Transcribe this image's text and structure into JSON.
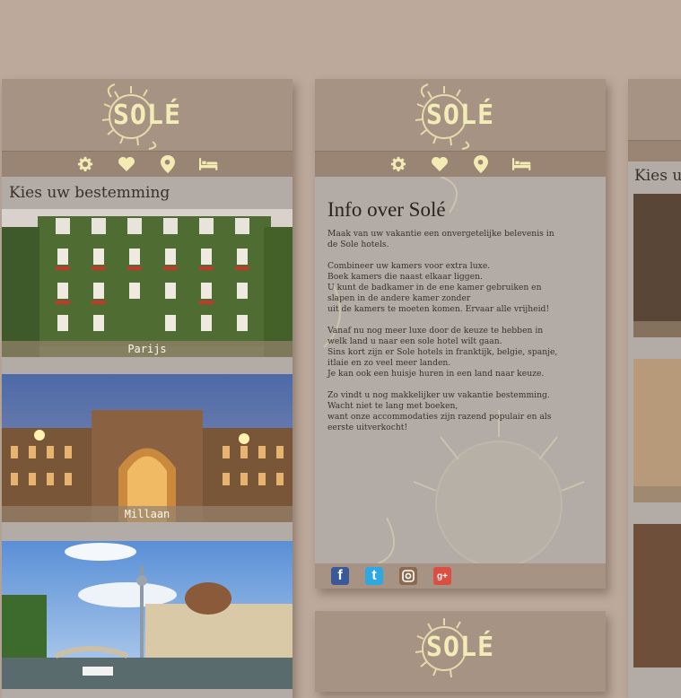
{
  "brand": {
    "logo_text": "SOLÉ"
  },
  "nav": {
    "settings_icon": "gear-icon",
    "favorites_icon": "heart-icon",
    "location_icon": "map-pin-icon",
    "booking_icon": "bed-icon"
  },
  "destinations_panel": {
    "title": "Kies uw bestemming",
    "cards": [
      {
        "label": "Parijs"
      },
      {
        "label": "Millaan"
      },
      {
        "label": ""
      }
    ]
  },
  "info_panel": {
    "title": "Info over Solé",
    "paragraphs": [
      "Maak van uw vakantie een onvergetelijke belevenis in\nde Sole hotels.",
      "Combineer uw kamers voor extra luxe.\nBoek kamers die naast elkaar liggen.\nU kunt de badkamer in de ene kamer gebruiken en\nslapen in de andere kamer zonder\nuit de kamers te moeten komen. Ervaar alle vrijheid!",
      "Vanaf nu nog meer luxe door de keuze te hebben in\nwelk land u naar een sole hotel wilt gaan.\nSins kort zijn er Sole hotels in franktijk, belgie, spanje,\nitlaie en zo veel meer landen.\nJe kan ook een huisje huren in een land naar keuze.",
      "Zo vindt u nog makkelijker uw vakantie bestemming.\nWacht niet te lang met boeken,\nwant onze accommodaties zijn razend populair en als\neerste uitverkocht!"
    ],
    "social": {
      "facebook": "f",
      "twitter": "t",
      "instagram": "instagram-icon",
      "googleplus": "g+"
    }
  },
  "right_panel": {
    "title": "Kies uw"
  },
  "colors": {
    "background": "#bca99b",
    "panel": "#a79383",
    "navbar": "#9a8574",
    "logo": "#f2ecb6",
    "content": "#b3aca6"
  }
}
